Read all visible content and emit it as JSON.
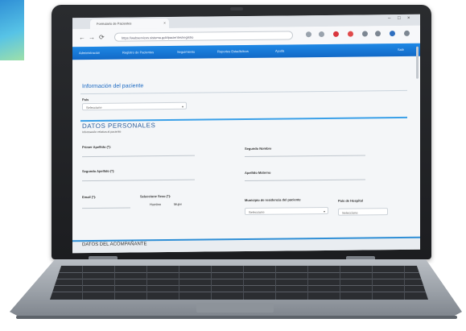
{
  "browser": {
    "tab_title": "Formulario de Pacientes",
    "tab_close": "×",
    "url": "https://webservices.sistema.gob/pacientes/registro",
    "nav_back": "←",
    "nav_forward": "→",
    "nav_reload": "⟳",
    "window_controls": [
      "–",
      "□",
      "×"
    ]
  },
  "app_nav": {
    "items": [
      "Administración",
      "Registro de Pacientes",
      "Seguimiento",
      "Reportes Estadísticos",
      "Ayuda"
    ],
    "right_item": "Salir"
  },
  "form": {
    "panel_title": "Información del paciente",
    "field1_label": "País",
    "field1_value": "Seleccione",
    "section_title": "DATOS PERSONALES",
    "section_subtitle": "Información relativa al paciente",
    "first_surname_label": "Primer Apellido (*):",
    "second_name_label": "Segundo Nombre",
    "second_surname_label": "Segundo Apellido (*):",
    "other_label": "Apellido Materno",
    "email_label": "Email (*):",
    "sex_label": "Seleccione Sexo (*):",
    "sex_option_1": "Hombre",
    "sex_option_2": "Mujer",
    "municipality_label": "Municipio de residencia del paciente",
    "municipality_value": "Seleccione",
    "hospital_label": "País de Hospital",
    "hospital_value": "Seleccione",
    "footer_section": "DATOS DEL ACOMPAÑANTE"
  },
  "colors": {
    "nav_blue": "#1e88e5",
    "accent_blue": "#3aa0e8",
    "lid": "#1c1d20",
    "chassis": "#9aa0a7"
  }
}
